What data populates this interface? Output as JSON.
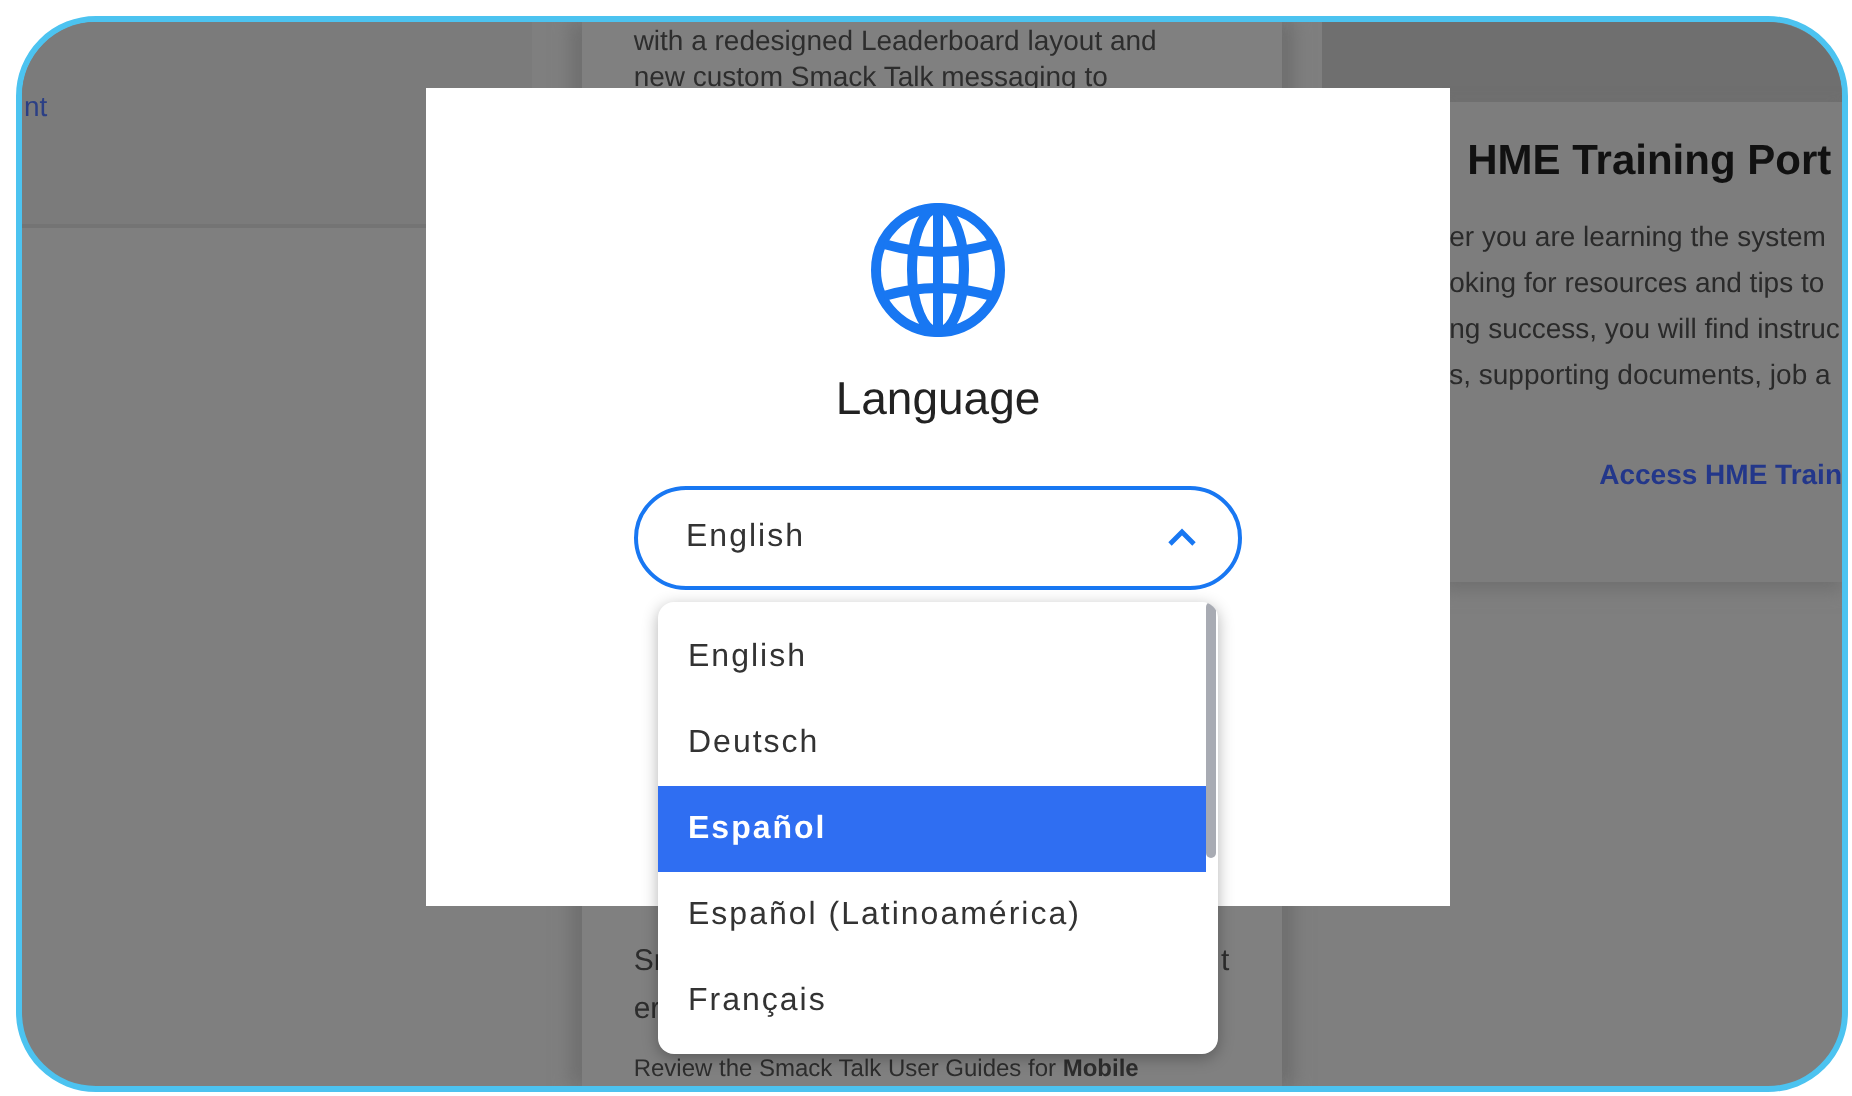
{
  "background": {
    "left_panel": {
      "link": "nt"
    },
    "middle_card": {
      "top_lines": [
        "with a redesigned Leaderboard layout and",
        "new custom Smack Talk messaging to"
      ],
      "fragments": [
        "Sr",
        "er"
      ],
      "trailing_fragment": "t",
      "guide_text": "Review the Smack Talk User Guides for **Mobile**"
    },
    "right_card": {
      "title": "HME Training Port",
      "lines": [
        "er you are learning the system",
        "oking for resources and tips to",
        "ng success, you will find instruc",
        "s, supporting documents, job a"
      ],
      "link": "Access HME Train"
    }
  },
  "dialog": {
    "title": "Language",
    "select": {
      "value": "English",
      "expanded": true
    },
    "options": [
      {
        "label": "English",
        "selected": false
      },
      {
        "label": "Deutsch",
        "selected": false
      },
      {
        "label": "Español",
        "selected": true
      },
      {
        "label": "Español (Latinoamérica)",
        "selected": false
      },
      {
        "label": "Français",
        "selected": false
      }
    ]
  }
}
